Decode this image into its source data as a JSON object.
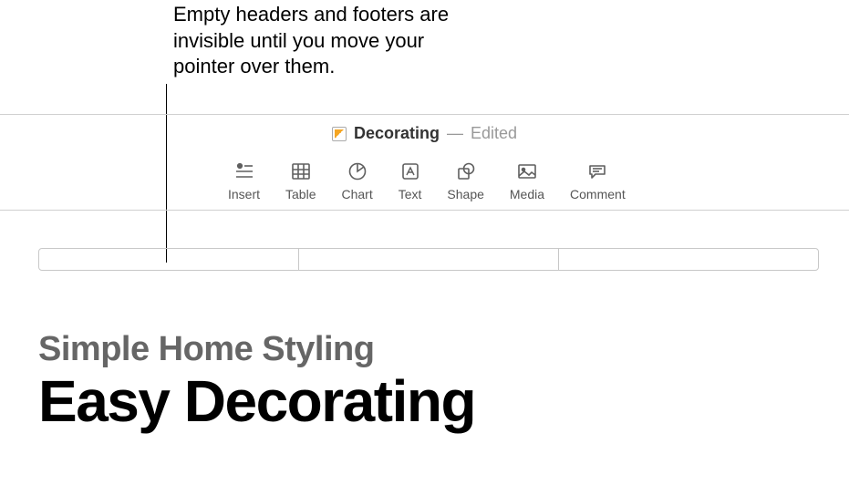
{
  "callout": {
    "text": "Empty headers and footers are invisible until you move your pointer over them."
  },
  "titlebar": {
    "doc_name": "Decorating",
    "status": "Edited"
  },
  "toolbar": {
    "insert": "Insert",
    "table": "Table",
    "chart": "Chart",
    "text": "Text",
    "shape": "Shape",
    "media": "Media",
    "comment": "Comment"
  },
  "document": {
    "subtitle": "Simple Home Styling",
    "title": "Easy Decorating"
  }
}
